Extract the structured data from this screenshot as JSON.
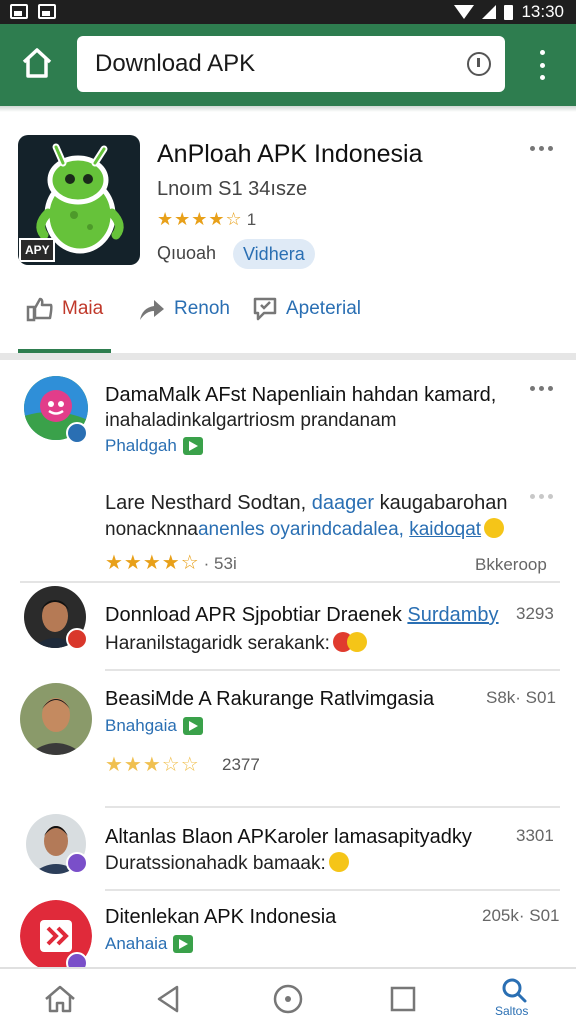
{
  "status_bar": {
    "time": "13:30"
  },
  "top_bar": {
    "search_text": "Download APK"
  },
  "app": {
    "title": "AnPloah APK Indonesia",
    "subtitle": "Lnoım  S1 34ısze",
    "stars": "★★★★☆",
    "rating_count": "1",
    "publisher": "Qıuoah",
    "chip": "Vidhera",
    "icon_badge": "APY"
  },
  "tabs": [
    {
      "label": "Maia",
      "icon": "thumbs-up-icon"
    },
    {
      "label": "Renoh",
      "icon": "share-icon"
    },
    {
      "label": "Apeterial",
      "icon": "report-icon"
    }
  ],
  "feed": {
    "item1": {
      "title": "DamaMalk AFst Napenliain hahdan kamard,",
      "line2": "inahaladinkalgartriosm prandanam",
      "tag": "Phaldgah"
    },
    "item2": {
      "line1_a": "Lare Nesthard Sodtan, ",
      "line1_link": "daager",
      "line1_b": " kaugabarohan",
      "line2_a": "nonacknna",
      "line2_link": "anenles oyarindcadalea, ",
      "line2_link2": "kaidoqat",
      "stars": "★★★★☆",
      "rating": "· 53i",
      "right": "Bkkeroop"
    },
    "item3": {
      "title_a": "Donnload APR Sjpobtiar Draenek ",
      "title_link": "Surdamby",
      "line2": "Haranilstagaridk serakank:",
      "right": "3293"
    },
    "item4": {
      "title": "BeasiMde A Rakurange Ratlvimgasia",
      "tag": "Bnahgaia",
      "stars": "★★★☆☆",
      "rating": "2377",
      "right": "S8k· S01"
    },
    "item5": {
      "title": "Altanlas Blaon APKaroler lamasapityadky",
      "line2": "Duratssionahadk bamaak:",
      "right": "3301"
    },
    "item6": {
      "title": "Ditenlekan APK Indonesia",
      "tag": "Anahaia",
      "right": "205k· S01"
    }
  },
  "bottom_nav": {
    "search_label": "Saltos"
  },
  "colors": {
    "accent": "#2e7d4f",
    "link": "#2a6fb3",
    "star": "#e8a019",
    "like": "#c0392b"
  }
}
